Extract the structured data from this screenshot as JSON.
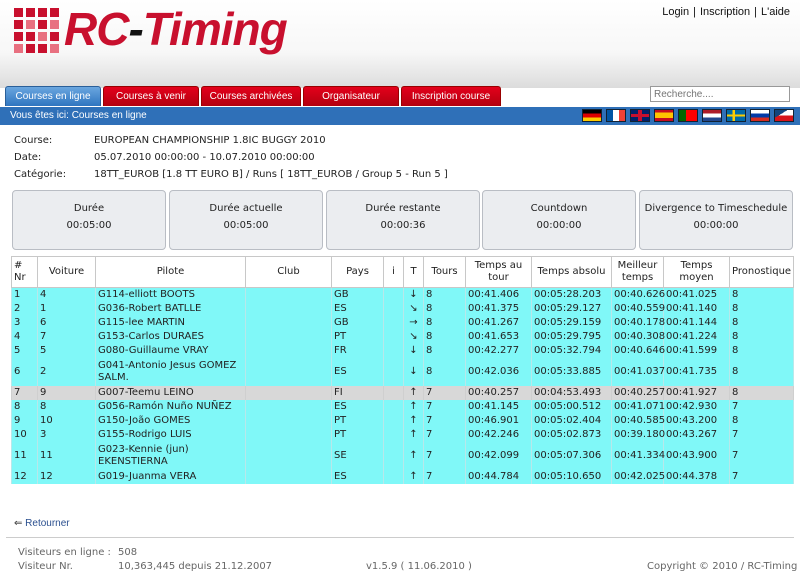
{
  "header": {
    "logo_text": "RC",
    "logo_dash": "-",
    "logo_text2": "Timing",
    "links": [
      "Login",
      "Inscription",
      "L'aide"
    ],
    "separator": "|"
  },
  "tabs": [
    "Courses en ligne",
    "Courses à venir",
    "Courses archivées",
    "Organisateur",
    "Inscription course"
  ],
  "search": {
    "placeholder": "Recherche...."
  },
  "breadcrumb": "Vous êtes ici: Courses en ligne",
  "flags": [
    "germany",
    "france",
    "united-kingdom",
    "spain",
    "portugal",
    "netherlands",
    "sweden",
    "russia",
    "czech-republic"
  ],
  "race": {
    "course_label": "Course:",
    "course_value": "EUROPEAN CHAMPIONSHIP 1.8IC BUGGY 2010",
    "date_label": "Date:",
    "date_value": "05.07.2010 00:00:00 - 10.07.2010 00:00:00",
    "cat_label": "Catégorie:",
    "cat_value": "18TT_EUROB [1.8 TT EURO B] / Runs [ 18TT_EUROB / Group 5 - Run 5 ]"
  },
  "timers": [
    {
      "label": "Durée",
      "value": "00:05:00"
    },
    {
      "label": "Durée actuelle",
      "value": "00:05:00"
    },
    {
      "label": "Durée restante",
      "value": "00:00:36"
    },
    {
      "label": "Countdown",
      "value": "00:00:00"
    },
    {
      "label": "Divergence to Timeschedule",
      "value": "00:00:00"
    }
  ],
  "table": {
    "headers": [
      "# Nr",
      "Voiture",
      "Pilote",
      "Club",
      "Pays",
      "i",
      "T",
      "Tours",
      "Temps au tour",
      "Temps absolu",
      "Meilleur temps",
      "Temps moyen",
      "Pronostique"
    ],
    "rows": [
      [
        "1",
        "4",
        "G114-elliott BOOTS",
        "",
        "GB",
        "",
        "↓",
        "8",
        "00:41.406",
        "00:05:28.203",
        "00:40.626",
        "00:41.025",
        "8"
      ],
      [
        "2",
        "1",
        "G036-Robert BATLLE",
        "",
        "ES",
        "",
        "↘",
        "8",
        "00:41.375",
        "00:05:29.127",
        "00:40.559",
        "00:41.140",
        "8"
      ],
      [
        "3",
        "6",
        "G115-lee MARTIN",
        "",
        "GB",
        "",
        "→",
        "8",
        "00:41.267",
        "00:05:29.159",
        "00:40.178",
        "00:41.144",
        "8"
      ],
      [
        "4",
        "7",
        "G153-Carlos DURAES",
        "",
        "PT",
        "",
        "↘",
        "8",
        "00:41.653",
        "00:05:29.795",
        "00:40.308",
        "00:41.224",
        "8"
      ],
      [
        "5",
        "5",
        "G080-Guillaume VRAY",
        "",
        "FR",
        "",
        "↓",
        "8",
        "00:42.277",
        "00:05:32.794",
        "00:40.646",
        "00:41.599",
        "8"
      ],
      [
        "6",
        "2",
        "G041-Antonio Jesus GOMEZ SALM.",
        "",
        "ES",
        "",
        "↓",
        "8",
        "00:42.036",
        "00:05:33.885",
        "00:41.037",
        "00:41.735",
        "8"
      ],
      [
        "7",
        "9",
        "G007-Teemu LEINO",
        "",
        "FI",
        "",
        "↑",
        "7",
        "00:40.257",
        "00:04:53.493",
        "00:40.257",
        "00:41.927",
        "8"
      ],
      [
        "8",
        "8",
        "G056-Ramón Nuño NUÑEZ",
        "",
        "ES",
        "",
        "↑",
        "7",
        "00:41.145",
        "00:05:00.512",
        "00:41.071",
        "00:42.930",
        "7"
      ],
      [
        "9",
        "10",
        "G150-João GOMES",
        "",
        "PT",
        "",
        "↑",
        "7",
        "00:46.901",
        "00:05:02.404",
        "00:40.585",
        "00:43.200",
        "8"
      ],
      [
        "10",
        "3",
        "G155-Rodrigo LUIS",
        "",
        "PT",
        "",
        "↑",
        "7",
        "00:42.246",
        "00:05:02.873",
        "00:39.180",
        "00:43.267",
        "7"
      ],
      [
        "11",
        "11",
        "G023-Kennie (jun) EKENSTIERNA",
        "",
        "SE",
        "",
        "↑",
        "7",
        "00:42.099",
        "00:05:07.306",
        "00:41.334",
        "00:43.900",
        "7"
      ],
      [
        "12",
        "12",
        "G019-Juanma VERA",
        "",
        "ES",
        "",
        "↑",
        "7",
        "00:44.784",
        "00:05:10.650",
        "00:42.025",
        "00:44.378",
        "7"
      ]
    ]
  },
  "back_label": "Retourner",
  "footer": {
    "visitors_online_label": "Visiteurs en ligne :",
    "visitors_online_value": "508",
    "visitor_nr_label": "Visiteur Nr.",
    "visitor_nr_value": "10,363,445 depuis 21.12.2007",
    "version": "v1.5.9 ( 11.06.2010 )",
    "copyright": "Copyright © 2010 / RC-Timing"
  },
  "colors": {
    "accent_red": "#c8102e",
    "nav_blue": "#2f70b8",
    "row_cyan": "#80f8f8",
    "row_grey": "#d8d8d8"
  }
}
